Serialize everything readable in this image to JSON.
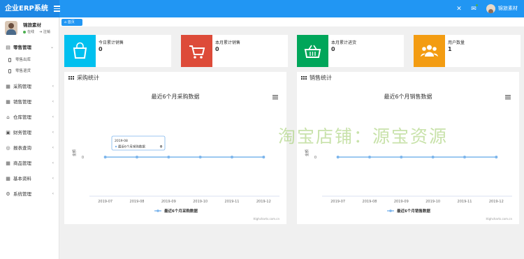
{
  "header": {
    "brand": "企业ERP系统",
    "user_name": "锦旅素材",
    "icons": [
      "expand-icon",
      "message-icon",
      "avatar"
    ]
  },
  "sidebar": {
    "user": {
      "name": "锦旅素材",
      "status": "在线",
      "logout": "注销"
    },
    "items": [
      {
        "label": "零售管理",
        "icon": "shopping-icon",
        "expanded": true,
        "children": [
          {
            "label": "零售出库"
          },
          {
            "label": "零售退货"
          }
        ]
      },
      {
        "label": "采购管理",
        "icon": "purchase-icon"
      },
      {
        "label": "销售管理",
        "icon": "sales-icon"
      },
      {
        "label": "仓库管理",
        "icon": "warehouse-icon"
      },
      {
        "label": "财务管理",
        "icon": "finance-icon"
      },
      {
        "label": "报表查询",
        "icon": "report-icon"
      },
      {
        "label": "商品管理",
        "icon": "goods-icon"
      },
      {
        "label": "基本资料",
        "icon": "basic-data-icon"
      },
      {
        "label": "系统管理",
        "icon": "settings-icon"
      }
    ]
  },
  "tabs": {
    "home": "首页"
  },
  "stats": [
    {
      "label": "今日累计销售",
      "value": "0",
      "color": "#00c0ef",
      "icon": "bag-icon"
    },
    {
      "label": "本月累计销售",
      "value": "0",
      "color": "#dd4b39",
      "icon": "cart-icon"
    },
    {
      "label": "本月累计进货",
      "value": "0",
      "color": "#00a65a",
      "icon": "basket-icon"
    },
    {
      "label": "用户数量",
      "value": "1",
      "color": "#f39c12",
      "icon": "users-icon"
    }
  ],
  "panels": {
    "purchase": {
      "title": "采购统计"
    },
    "sales": {
      "title": "销售统计"
    }
  },
  "chart_data": [
    {
      "type": "line",
      "title": "最近6个月采购数据",
      "categories": [
        "2019-07",
        "2019-08",
        "2019-09",
        "2019-10",
        "2019-11",
        "2019-12"
      ],
      "series": [
        {
          "name": "最近6个月采购数据",
          "values": [
            0,
            0,
            0,
            0,
            0,
            0
          ]
        }
      ],
      "ylabel": "金额",
      "ytick": "0",
      "tooltip": {
        "x": "2019-08",
        "series": "最近6个月采购数据",
        "value": "0"
      },
      "credits": "Highcharts.com.cn",
      "legend": "bottom"
    },
    {
      "type": "line",
      "title": "最近6个月销售数据",
      "categories": [
        "2019-07",
        "2019-08",
        "2019-09",
        "2019-10",
        "2019-11",
        "2019-12"
      ],
      "series": [
        {
          "name": "最近6个月销售数据",
          "values": [
            0,
            0,
            0,
            0,
            0,
            0
          ]
        }
      ],
      "ylabel": "金额",
      "ytick": "0",
      "credits": "Highcharts.com.cn",
      "legend": "bottom"
    }
  ],
  "colors": {
    "header": "#2196f3",
    "series": "#7cb5ec"
  },
  "watermark": "淘宝店铺：源宝资源"
}
